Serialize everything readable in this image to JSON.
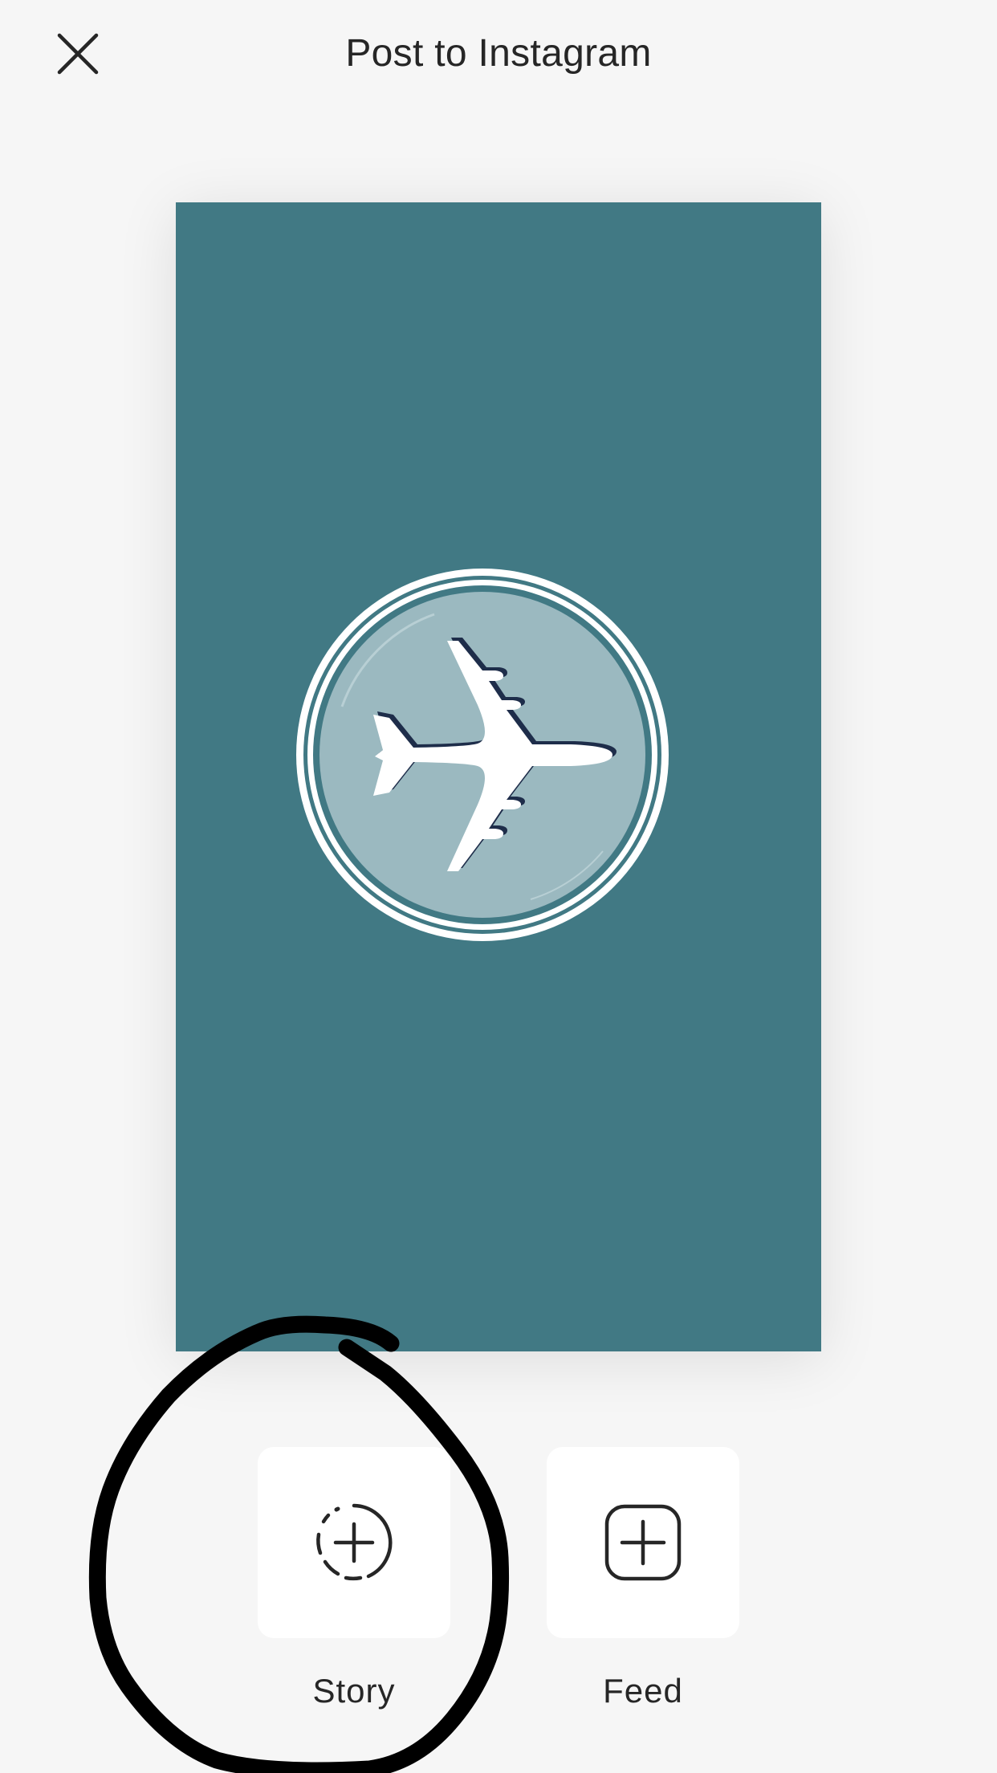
{
  "header": {
    "title": "Post to Instagram",
    "close_icon": "close-icon"
  },
  "preview": {
    "background_color": "#417984",
    "emblem_fill": "#9bb9c0",
    "emblem_ring": "#ffffff",
    "icon": "airplane-icon"
  },
  "options": [
    {
      "label": "Story",
      "icon": "story-add-icon"
    },
    {
      "label": "Feed",
      "icon": "feed-add-icon"
    }
  ],
  "colors": {
    "page_background": "#f6f6f6",
    "text": "#262626",
    "annotation_ink": "#000000"
  }
}
